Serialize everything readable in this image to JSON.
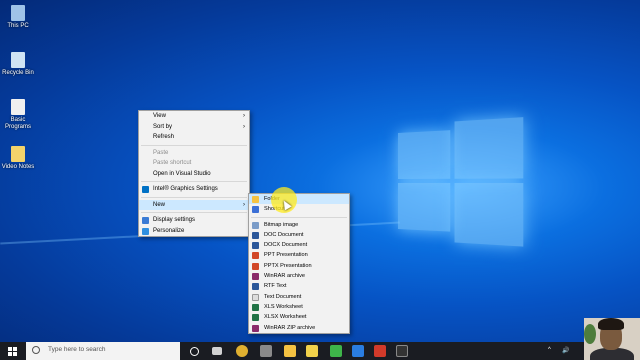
{
  "desktop": {
    "icons": [
      {
        "label": "This PC",
        "icon": "computer-icon",
        "color": "#9fc3e8"
      },
      {
        "label": "Recycle Bin",
        "icon": "recycle-bin-icon",
        "color": "#cfe4f5"
      },
      {
        "label": "Basic Programs",
        "icon": "file-icon",
        "color": "#f0f0f0"
      },
      {
        "label": "Video Notes",
        "icon": "file-icon",
        "color": "#f3d36b"
      }
    ]
  },
  "context_menu": {
    "items": {
      "view": "View",
      "sort_by": "Sort by",
      "refresh": "Refresh",
      "paste": "Paste",
      "paste_shortcut": "Paste shortcut",
      "open_vs": "Open in Visual Studio",
      "intel": "Intel® Graphics Settings",
      "new": "New",
      "display": "Display settings",
      "personalize": "Personalize"
    },
    "submenu_arrow": "›"
  },
  "new_submenu": {
    "items": [
      {
        "label": "Folder",
        "icon": "folder-icon",
        "color": "#f5c242"
      },
      {
        "label": "Shortcut",
        "icon": "shortcut-icon",
        "color": "#3b6fd6"
      },
      {
        "label": "Bitmap image",
        "icon": "bitmap-icon",
        "color": "#7a9cc8"
      },
      {
        "label": "DOC Document",
        "icon": "word-icon",
        "color": "#2b579a"
      },
      {
        "label": "DOCX Document",
        "icon": "word-icon",
        "color": "#2b579a"
      },
      {
        "label": "PPT Presentation",
        "icon": "powerpoint-icon",
        "color": "#d24726"
      },
      {
        "label": "PPTX Presentation",
        "icon": "powerpoint-icon",
        "color": "#d24726"
      },
      {
        "label": "WinRAR archive",
        "icon": "winrar-icon",
        "color": "#8a2a6a"
      },
      {
        "label": "RTF Text",
        "icon": "rtf-icon",
        "color": "#2b579a"
      },
      {
        "label": "Text Document",
        "icon": "text-icon",
        "color": "#dddddd"
      },
      {
        "label": "XLS Worksheet",
        "icon": "excel-icon",
        "color": "#217346"
      },
      {
        "label": "XLSX Worksheet",
        "icon": "excel-icon",
        "color": "#217346"
      },
      {
        "label": "WinRAR ZIP archive",
        "icon": "winrar-zip-icon",
        "color": "#8a2a6a"
      }
    ]
  },
  "taskbar": {
    "search_placeholder": "Type here to search",
    "pinned": [
      {
        "name": "task-view-icon",
        "color": "#ffffff"
      },
      {
        "name": "people-icon",
        "color": "#cccccc"
      },
      {
        "name": "chrome-icon",
        "color": "#e0b030"
      },
      {
        "name": "app-icon",
        "color": "#8a8a8a"
      },
      {
        "name": "file-explorer-icon",
        "color": "#f5c242"
      },
      {
        "name": "sticky-notes-icon",
        "color": "#f1d14b"
      },
      {
        "name": "camtasia-icon",
        "color": "#3eb54a"
      },
      {
        "name": "ms-store-icon",
        "color": "#2a7de1"
      },
      {
        "name": "recorder-icon",
        "color": "#d23a2a"
      },
      {
        "name": "terminal-icon",
        "color": "#333333"
      }
    ],
    "tray": {
      "chevron": "^",
      "volume": "🔊"
    }
  }
}
